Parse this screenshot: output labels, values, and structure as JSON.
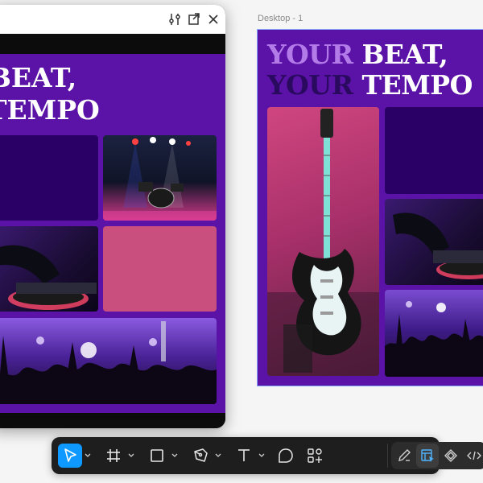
{
  "canvas": {
    "frame_label": "Desktop - 1",
    "headline": {
      "line1_accent": "YOUR",
      "line1_rest": "BEAT,",
      "line2_accent": "YOUR",
      "line2_rest": "TEMPO"
    }
  },
  "preview": {
    "headline": {
      "line1": "BEAT,",
      "line2": "TEMPO"
    }
  },
  "colors": {
    "page_purple": "#5a12a7",
    "dark_purple_tile": "#2b0066",
    "pink_tile": "#c94f7e",
    "accent_lavender": "#b27be8",
    "accent_dark": "#2a0a5e",
    "tool_active": "#0d99ff"
  },
  "toolbar": {
    "tools": [
      "move-tool",
      "frame-tool",
      "shape-tool",
      "pen-tool",
      "text-tool",
      "comment-tool",
      "components-tool"
    ],
    "modes": [
      "draw-mode",
      "design-mode",
      "prototype-mode",
      "dev-mode"
    ]
  }
}
